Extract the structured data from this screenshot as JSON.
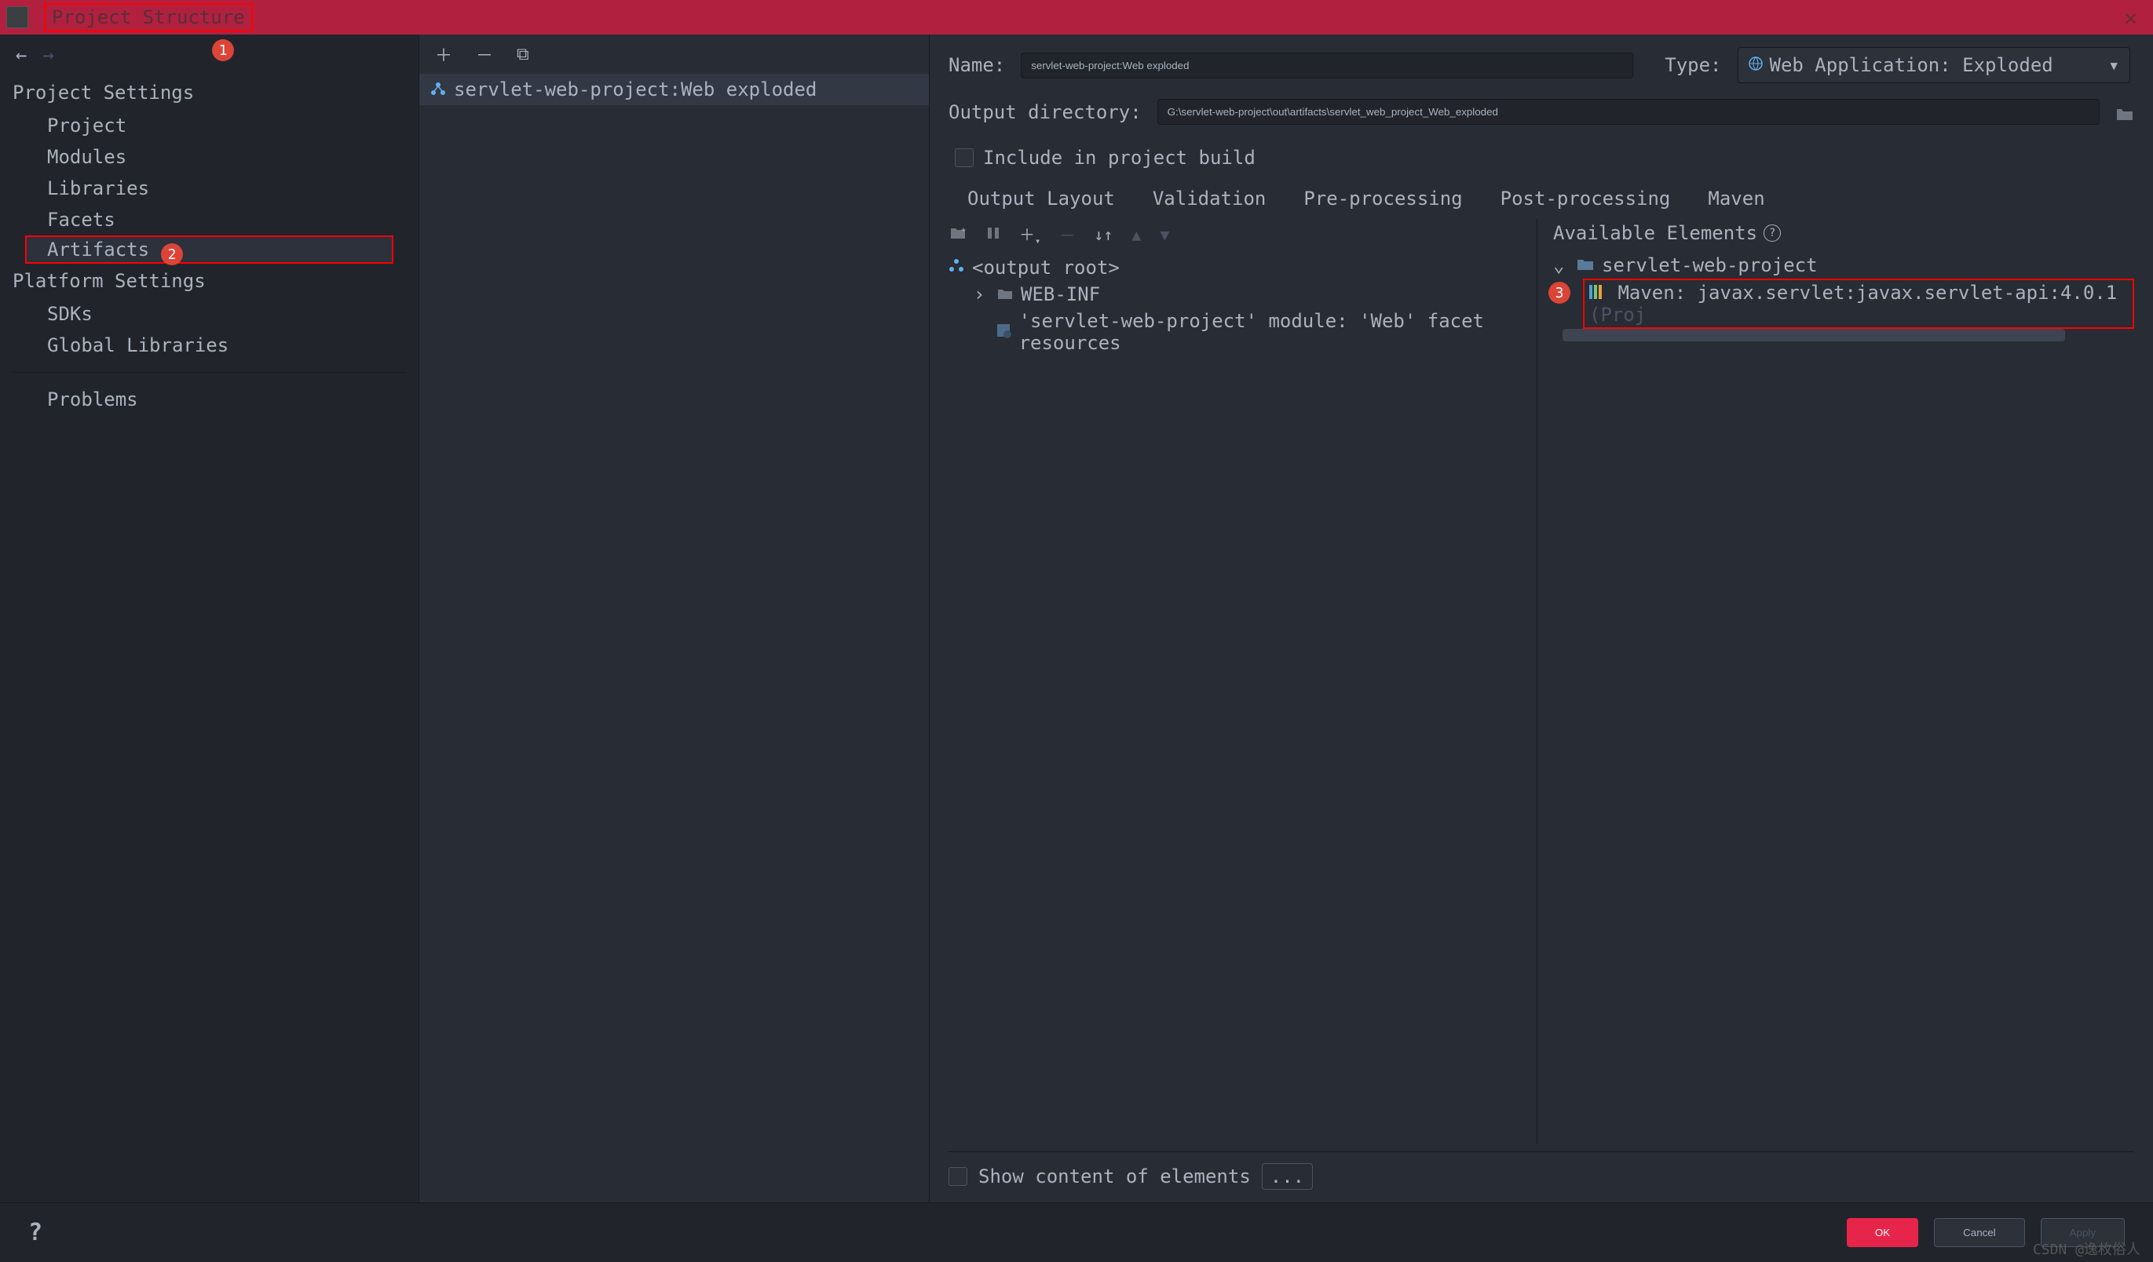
{
  "window": {
    "title": "Project Structure"
  },
  "sidebar": {
    "section1": "Project Settings",
    "section2": "Platform Settings",
    "items": {
      "project": "Project",
      "modules": "Modules",
      "libraries": "Libraries",
      "facets": "Facets",
      "artifacts": "Artifacts",
      "sdks": "SDKs",
      "global_libraries": "Global Libraries",
      "problems": "Problems"
    }
  },
  "badges": {
    "b1": "1",
    "b2": "2",
    "b3": "3"
  },
  "middle": {
    "artifact": "servlet-web-project:Web exploded"
  },
  "form": {
    "name_label": "Name:",
    "name_value": "servlet-web-project:Web exploded",
    "type_label": "Type:",
    "type_value": "Web Application: Exploded",
    "outdir_label": "Output directory:",
    "outdir_value": "G:\\servlet-web-project\\out\\artifacts\\servlet_web_project_Web_exploded",
    "include_label": "Include in project build"
  },
  "tabs": {
    "t1": "Output Layout",
    "t2": "Validation",
    "t3": "Pre-processing",
    "t4": "Post-processing",
    "t5": "Maven"
  },
  "tree": {
    "root": "<output root>",
    "webinf": "WEB-INF",
    "facet": "'servlet-web-project' module: 'Web' facet resources"
  },
  "available": {
    "header": "Available Elements",
    "project": "servlet-web-project",
    "maven": "Maven: javax.servlet:javax.servlet-api:4.0.1",
    "proj_suffix": "(Proj"
  },
  "bottom": {
    "show_content": "Show content of elements",
    "ellipsis": "..."
  },
  "footer": {
    "ok": "OK",
    "cancel": "Cancel",
    "apply": "Apply"
  },
  "watermark": "CSDN @逸枚俗人"
}
